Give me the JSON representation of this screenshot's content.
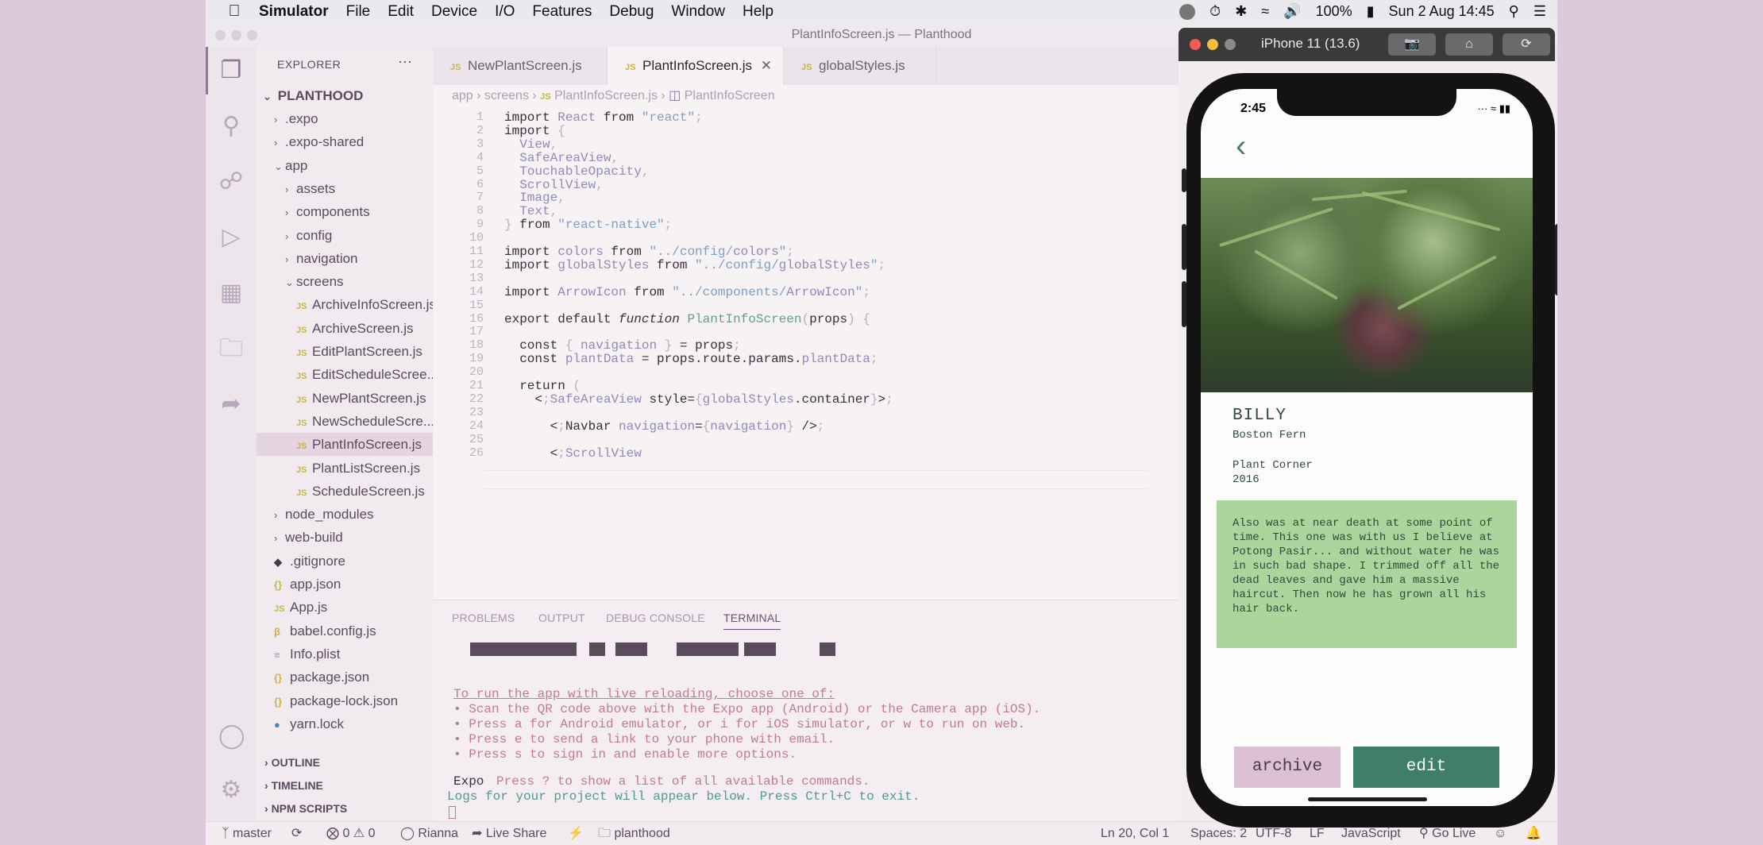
{
  "menubar": {
    "app": "Simulator",
    "items": [
      "File",
      "Edit",
      "Device",
      "I/O",
      "Features",
      "Debug",
      "Window",
      "Help"
    ],
    "battery": "100%",
    "datetime": "Sun 2 Aug  14:45"
  },
  "vscode": {
    "title": "PlantInfoScreen.js — Planthood",
    "explorer_header": "EXPLORER",
    "project": "PLANTHOOD",
    "tree": [
      {
        "label": ".expo",
        "depth": 1,
        "type": "folder"
      },
      {
        "label": ".expo-shared",
        "depth": 1,
        "type": "folder"
      },
      {
        "label": "app",
        "depth": 1,
        "type": "folder-open"
      },
      {
        "label": "assets",
        "depth": 2,
        "type": "folder"
      },
      {
        "label": "components",
        "depth": 2,
        "type": "folder"
      },
      {
        "label": "config",
        "depth": 2,
        "type": "folder"
      },
      {
        "label": "navigation",
        "depth": 2,
        "type": "folder"
      },
      {
        "label": "screens",
        "depth": 2,
        "type": "folder-open"
      },
      {
        "label": "ArchiveInfoScreen.js",
        "depth": 3,
        "type": "js"
      },
      {
        "label": "ArchiveScreen.js",
        "depth": 3,
        "type": "js"
      },
      {
        "label": "EditPlantScreen.js",
        "depth": 3,
        "type": "js"
      },
      {
        "label": "EditScheduleScree...",
        "depth": 3,
        "type": "js"
      },
      {
        "label": "NewPlantScreen.js",
        "depth": 3,
        "type": "js"
      },
      {
        "label": "NewScheduleScre...",
        "depth": 3,
        "type": "js"
      },
      {
        "label": "PlantInfoScreen.js",
        "depth": 3,
        "type": "js",
        "selected": true
      },
      {
        "label": "PlantListScreen.js",
        "depth": 3,
        "type": "js"
      },
      {
        "label": "ScheduleScreen.js",
        "depth": 3,
        "type": "js"
      },
      {
        "label": "node_modules",
        "depth": 1,
        "type": "folder"
      },
      {
        "label": "web-build",
        "depth": 1,
        "type": "folder"
      },
      {
        "label": ".gitignore",
        "depth": 1,
        "type": "git"
      },
      {
        "label": "app.json",
        "depth": 1,
        "type": "json"
      },
      {
        "label": "App.js",
        "depth": 1,
        "type": "js"
      },
      {
        "label": "babel.config.js",
        "depth": 1,
        "type": "babel"
      },
      {
        "label": "Info.plist",
        "depth": 1,
        "type": "plain"
      },
      {
        "label": "package.json",
        "depth": 1,
        "type": "json"
      },
      {
        "label": "package-lock.json",
        "depth": 1,
        "type": "json"
      },
      {
        "label": "yarn.lock",
        "depth": 1,
        "type": "yarn"
      }
    ],
    "sections": [
      "OUTLINE",
      "TIMELINE",
      "NPM SCRIPTS"
    ],
    "tabs": [
      "NewPlantScreen.js",
      "PlantInfoScreen.js",
      "globalStyles.js"
    ],
    "breadcrumb": [
      "app",
      "screens",
      "PlantInfoScreen.js",
      "PlantInfoScreen"
    ],
    "line_numbers": [
      "1",
      "2",
      "3",
      "4",
      "5",
      "6",
      "7",
      "8",
      "9",
      "10",
      "11",
      "12",
      "13",
      "14",
      "15",
      "16",
      "17",
      "18",
      "19",
      "20",
      "21",
      "22",
      "23",
      "24",
      "25",
      "26"
    ],
    "code": [
      "import React from \"react\";",
      "import {",
      "  View,",
      "  SafeAreaView,",
      "  TouchableOpacity,",
      "  ScrollView,",
      "  Image,",
      "  Text,",
      "} from \"react-native\";",
      "",
      "import colors from \"../config/colors\";",
      "import globalStyles from \"../config/globalStyles\";",
      "",
      "import ArrowIcon from \"../components/ArrowIcon\";",
      "",
      "export default function PlantInfoScreen(props) {",
      "",
      "  const { navigation } = props;",
      "  const plantData = props.route.params.plantData;",
      "",
      "  return (",
      "    <SafeAreaView style={globalStyles.container}>",
      "",
      "      <Navbar navigation={navigation} />",
      "",
      "      <ScrollView"
    ],
    "panel_tabs": [
      "PROBLEMS",
      "OUTPUT",
      "DEBUG CONSOLE",
      "TERMINAL"
    ],
    "terminal": {
      "heading": "To run the app with live reloading, choose one of:",
      "bullets": [
        "• Scan the QR code above with the Expo app (Android) or the Camera app (iOS).",
        "• Press a for Android emulator, or i for iOS simulator, or w to run on web.",
        "• Press e to send a link to your phone with email.",
        "• Press s to sign in and enable more options."
      ],
      "expo_label": "Expo",
      "expo_hint": "Press ? to show a list of all available commands.",
      "logs": "Logs for your project will appear below. Press Ctrl+C to exit."
    },
    "status": {
      "branch": "master",
      "problems": "0",
      "warnings": "0",
      "user": "Rianna",
      "liveshare": "Live Share",
      "folder": "planthood",
      "position": "Ln 20, Col 1",
      "spaces": "Spaces: 2",
      "encoding": "UTF-8",
      "eol": "LF",
      "language": "JavaScript",
      "golive": "Go Live"
    }
  },
  "simulator": {
    "device": "iPhone 11 (13.6)",
    "time": "2:45",
    "plant": {
      "name": "BILLY",
      "species": "Boston Fern",
      "location": "Plant Corner",
      "year": "2016",
      "notes": "Also was at near death at some point of time. This one was with us I believe at Potong Pasir... and without water he was in such bad shape. I trimmed off all the dead leaves and gave him a massive haircut. Then now he has grown all his hair back."
    },
    "buttons": {
      "archive": "archive",
      "edit": "edit"
    }
  },
  "colors": {
    "accent_green": "#3f7f68",
    "note_bg": "#acd49d",
    "archive_bg": "#dcc0d4"
  }
}
